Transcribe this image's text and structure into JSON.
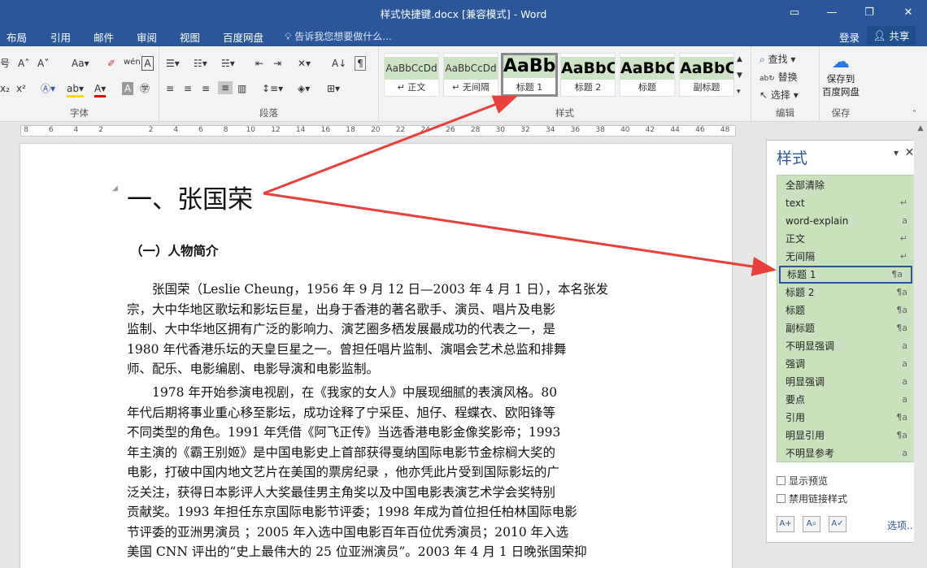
{
  "window": {
    "title": "样式快捷键.docx [兼容模式] - Word",
    "ribbon_display_icon": "ribbon-options-icon",
    "restore_icon": "restore-icon",
    "close_icon": "close-icon"
  },
  "menu": {
    "tabs": [
      "布局",
      "引用",
      "邮件",
      "审阅",
      "视图",
      "百度网盘"
    ],
    "tell_me": "告诉我您想要做什么...",
    "login": "登录",
    "share": "共享"
  },
  "ribbon": {
    "font_group_label": "字体",
    "paragraph_group_label": "段落",
    "styles_group_label": "样式",
    "edit_group_label": "编辑",
    "save_group_label": "保存",
    "font_size_fragment": "号",
    "styles": [
      {
        "preview": "AaBbCcDd",
        "name": "↵ 正文"
      },
      {
        "preview": "AaBbCcDd",
        "name": "↵ 无间隔"
      },
      {
        "preview": "AaBb",
        "name": "标题 1"
      },
      {
        "preview": "AaBbC",
        "name": "标题 2"
      },
      {
        "preview": "AaBbC",
        "name": "标题"
      },
      {
        "preview": "AaBbC",
        "name": "副标题"
      }
    ],
    "find": "查找",
    "replace": "替换",
    "select": "选择",
    "save_to_baidu_line1": "保存到",
    "save_to_baidu_line2": "百度网盘"
  },
  "ruler": {
    "ticks": [
      "8",
      "6",
      "4",
      "2",
      "",
      "2",
      "4",
      "6",
      "8",
      "10",
      "12",
      "14",
      "16",
      "18",
      "20",
      "22",
      "24",
      "26",
      "28",
      "30",
      "32",
      "34",
      "36",
      "38",
      "40",
      "42",
      "44",
      "46",
      "48"
    ]
  },
  "document": {
    "heading1": "一、张国荣",
    "heading2": "（一）人物简介",
    "para1": [
      "　　张国荣（Leslie Cheung，1956 年 9 月 12 日—2003 年 4 月 1 日），本名张发",
      "宗，大中华地区歌坛和影坛巨星，出身于香港的著名歌手、演员、唱片及电影",
      "监制、大中华地区拥有广泛的影响力、演艺圈多栖发展最成功的代表之一，是",
      "1980 年代香港乐坛的天皇巨星之一。曾担任唱片监制、演唱会艺术总监和排舞",
      "师、配乐、电影编剧、电影导演和电影监制。"
    ],
    "para2": [
      "　　1978 年开始参演电视剧，在《我家的女人》中展现细腻的表演风格。80",
      "年代后期将事业重心移至影坛，成功诠释了宁采臣、旭仔、程蝶衣、欧阳锋等",
      "不同类型的角色。1991 年凭借《阿飞正传》当选香港电影金像奖影帝；1993",
      "年主演的《霸王别姬》是中国电影史上首部获得戛纳国际电影节金棕榈大奖的",
      "电影，打破中国内地文艺片在美国的票房纪录 ，他亦凭此片受到国际影坛的广",
      "泛关注，获得日本影评人大奖最佳男主角奖以及中国电影表演艺术学会奖特别",
      "贡献奖。1993 年担任东京国际电影节评委；1998 年成为首位担任柏林国际电影",
      "节评委的亚洲男演员 ；2005 年入选中国电影百年百位优秀演员；2010 年入选",
      "美国 CNN 评出的“史上最伟大的 25 位亚洲演员”。2003 年 4 月 1 日晚张国荣抑"
    ]
  },
  "styles_pane": {
    "title": "样式",
    "items": [
      {
        "name": "全部清除",
        "glyph": ""
      },
      {
        "name": "text",
        "glyph": "↵"
      },
      {
        "name": "word-explain",
        "glyph": "a"
      },
      {
        "name": "正文",
        "glyph": "↵"
      },
      {
        "name": "无间隔",
        "glyph": "↵"
      },
      {
        "name": "标题 1",
        "glyph": "¶a"
      },
      {
        "name": "标题 2",
        "glyph": "¶a"
      },
      {
        "name": "标题",
        "glyph": "¶a"
      },
      {
        "name": "副标题",
        "glyph": "¶a"
      },
      {
        "name": "不明显强调",
        "glyph": "a"
      },
      {
        "name": "强调",
        "glyph": "a"
      },
      {
        "name": "明显强调",
        "glyph": "a"
      },
      {
        "name": "要点",
        "glyph": "a"
      },
      {
        "name": "引用",
        "glyph": "¶a"
      },
      {
        "name": "明显引用",
        "glyph": "¶a"
      },
      {
        "name": "不明显参考",
        "glyph": "a"
      }
    ],
    "show_preview": "显示预览",
    "disable_linked": "禁用链接样式",
    "options": "选项..."
  },
  "colors": {
    "accent": "#2b579a",
    "style_highlight": "#c9e2bd",
    "arrow": "#e8403a"
  }
}
